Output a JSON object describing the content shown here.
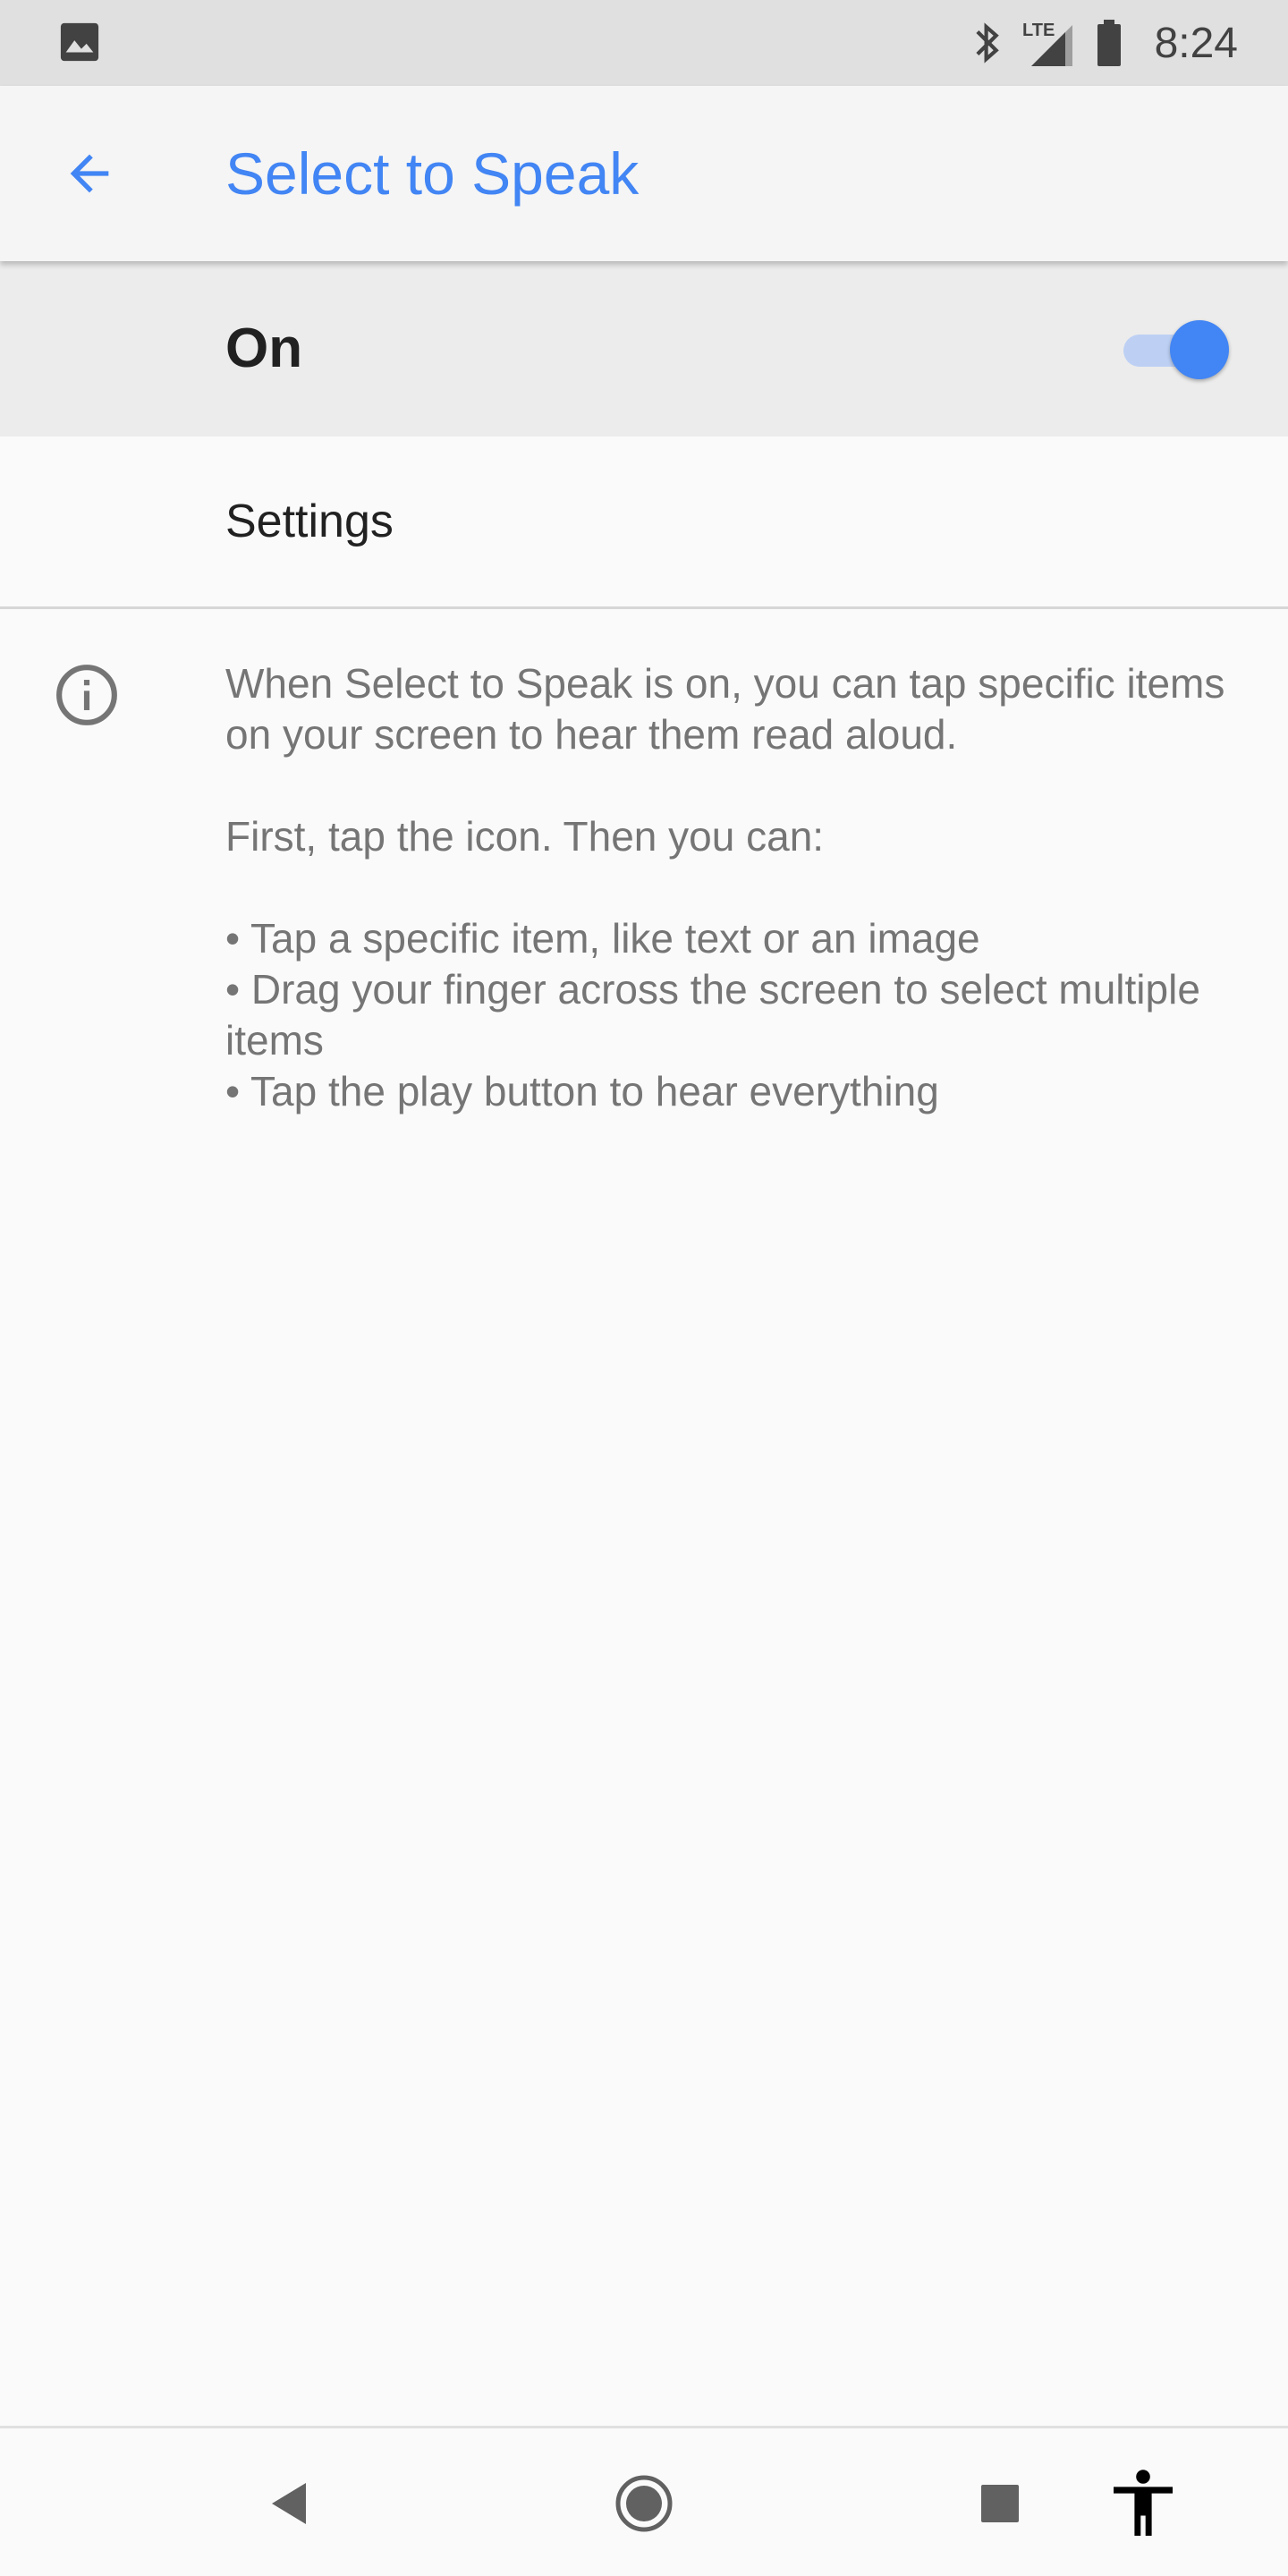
{
  "status_bar": {
    "time": "8:24",
    "icons": [
      "gallery-notification-icon",
      "bluetooth-icon",
      "lte-signal-icon",
      "battery-icon"
    ],
    "lte_label": "LTE"
  },
  "app_bar": {
    "title": "Select to Speak",
    "back_icon": "arrow-back-icon",
    "accent_color": "#4285f4"
  },
  "master_switch": {
    "label": "On",
    "checked": true
  },
  "settings_item": {
    "label": "Settings"
  },
  "info": {
    "icon": "info-icon",
    "paragraph_1": "When Select to Speak is on, you can tap specific items on your screen to hear them read aloud.",
    "paragraph_2": "First, tap the icon. Then you can:",
    "bullets": [
      "• Tap a specific item, like text or an image",
      "• Drag your finger across the screen to select multiple items",
      "• Tap the play button to hear everything"
    ]
  },
  "nav_bar": {
    "buttons": [
      "back-triangle-icon",
      "home-circle-icon",
      "recents-square-icon",
      "accessibility-icon"
    ]
  }
}
